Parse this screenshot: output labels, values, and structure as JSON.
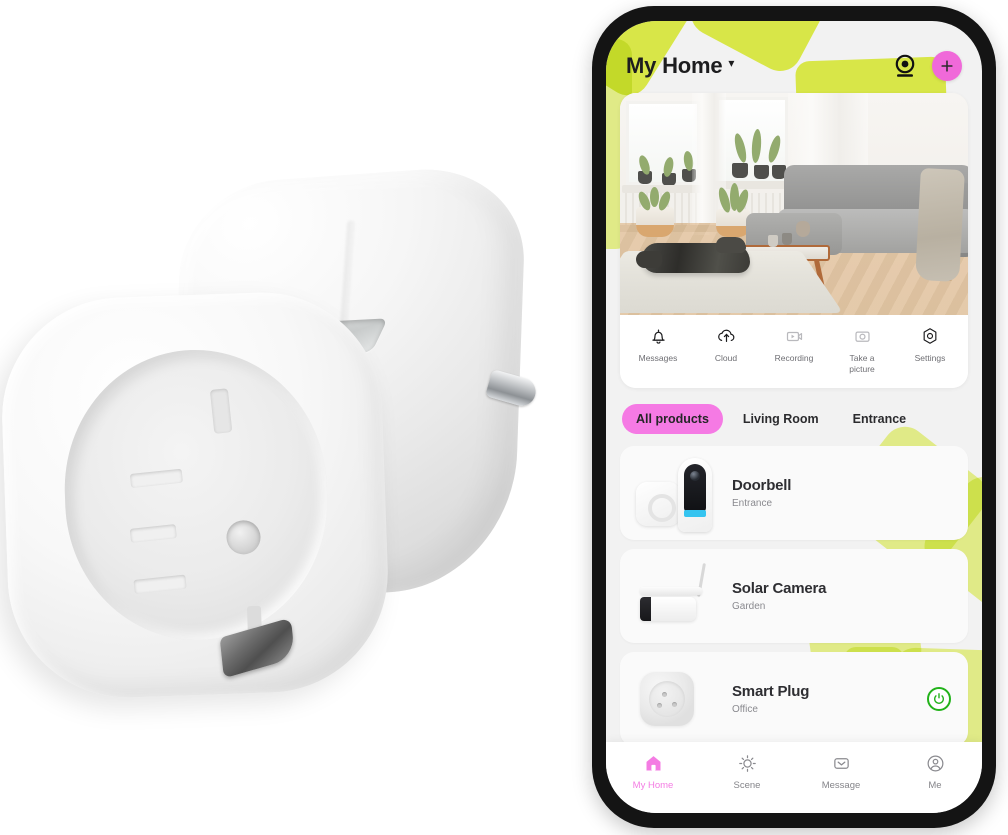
{
  "product": {
    "name": "smart-plug-photo",
    "description": "White Schuko smart plug with top button and side pin"
  },
  "colors": {
    "accent_pink": "#f069d9",
    "chip_pink": "#f57ae4",
    "nav_active_pink": "#f47ce3",
    "lime": "#d1e330",
    "power_green": "#22b21a",
    "phone_frame": "#141414",
    "screen_bg": "#f2f2f2"
  },
  "app": {
    "header": {
      "title": "My Home",
      "caret": "▾",
      "camera_icon": "webcam-icon",
      "add_icon": "plus-icon"
    },
    "hero": {
      "photo_alt": "Living room with grey sofa, dog on rug and herringbone floor",
      "quick_actions": [
        {
          "icon": "bell-icon",
          "label": "Messages"
        },
        {
          "icon": "cloud-upload-icon",
          "label": "Cloud"
        },
        {
          "icon": "recording-icon",
          "label": "Recording"
        },
        {
          "icon": "camera-snapshot-icon",
          "label": "Take a picture"
        },
        {
          "icon": "gear-icon",
          "label": "Settings"
        }
      ]
    },
    "filters": [
      {
        "label": "All products",
        "active": true
      },
      {
        "label": "Living Room",
        "active": false
      },
      {
        "label": "Entrance",
        "active": false
      }
    ],
    "devices": [
      {
        "name": "Doorbell",
        "room": "Entrance",
        "thumb": "doorbell-thumb",
        "toggle": null
      },
      {
        "name": "Solar Camera",
        "room": "Garden",
        "thumb": "solar-camera-thumb",
        "toggle": null
      },
      {
        "name": "Smart Plug",
        "room": "Office",
        "thumb": "smart-plug-thumb",
        "toggle": "power-on"
      }
    ],
    "bottom_nav": [
      {
        "icon": "home-icon",
        "label": "My Home",
        "active": true
      },
      {
        "icon": "sun-icon",
        "label": "Scene",
        "active": false
      },
      {
        "icon": "envelope-icon",
        "label": "Message",
        "active": false
      },
      {
        "icon": "user-circle-icon",
        "label": "Me",
        "active": false
      }
    ]
  }
}
